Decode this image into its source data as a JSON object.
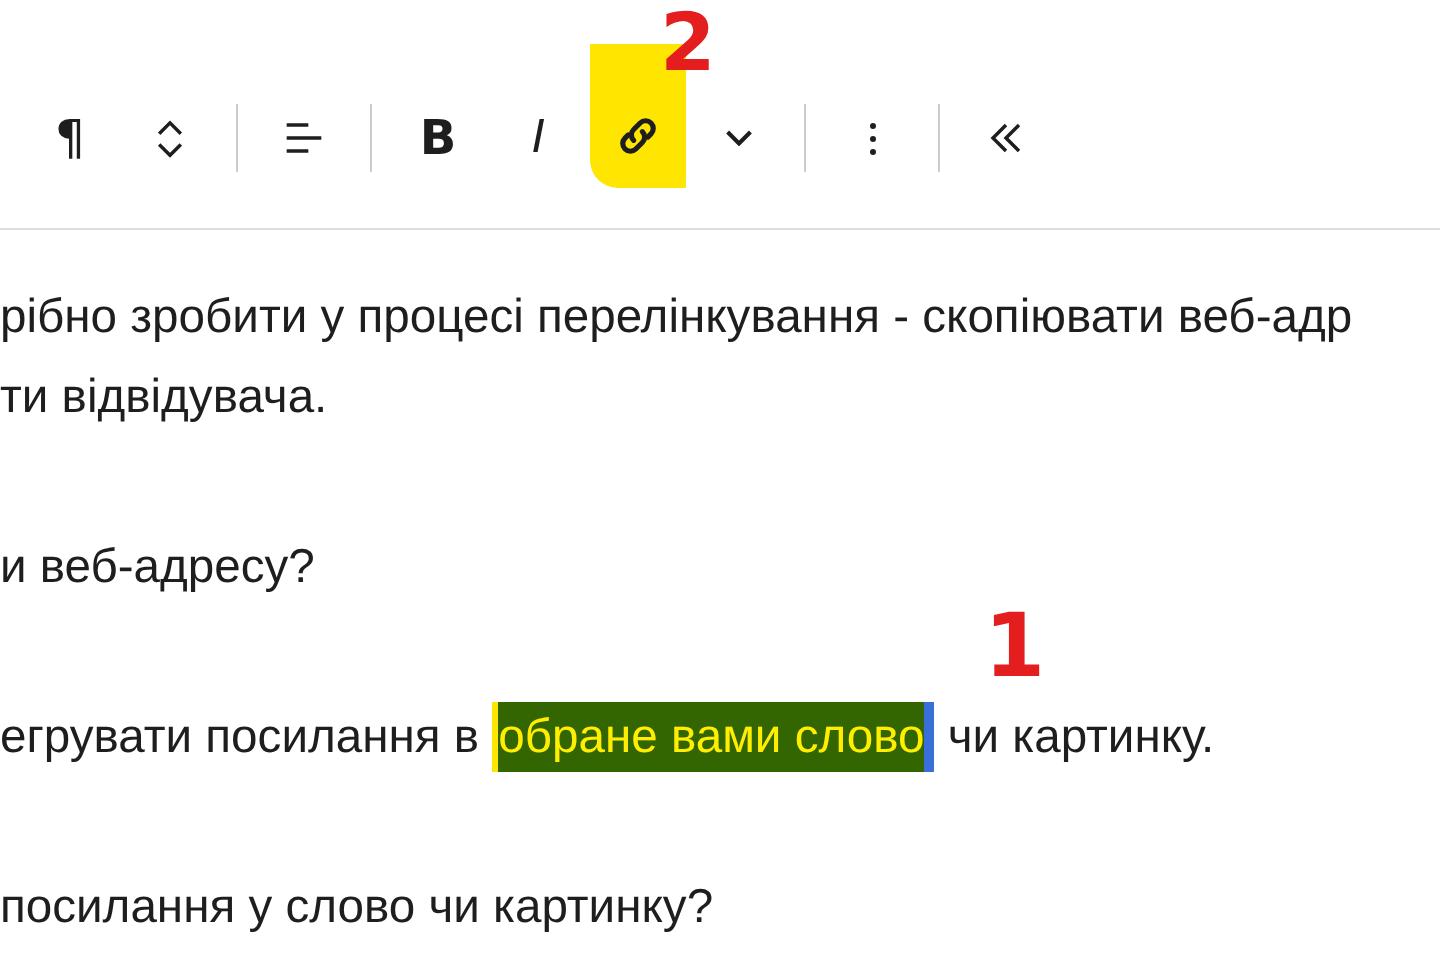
{
  "toolbar": {
    "groups": [
      [
        {
          "kind": "glyph",
          "label": "¶",
          "highlighted": false
        },
        {
          "kind": "mover",
          "highlighted": false
        }
      ],
      [
        {
          "kind": "align",
          "highlighted": false
        }
      ],
      [
        {
          "kind": "bold",
          "label": "B",
          "highlighted": false
        },
        {
          "kind": "italic",
          "label": "I",
          "highlighted": false
        },
        {
          "kind": "link",
          "highlighted": true
        },
        {
          "kind": "caret",
          "highlighted": false
        }
      ],
      [
        {
          "kind": "options",
          "highlighted": false
        }
      ],
      [
        {
          "kind": "collapse",
          "highlighted": false
        }
      ]
    ]
  },
  "paragraphs": [
    {
      "lines": [
        [
          {
            "text": "рібно зробити у процесі перелінкування - скопіювати веб-адр",
            "highlighted": false
          }
        ],
        [
          {
            "text": "ти відвідувача.",
            "highlighted": false
          }
        ]
      ]
    },
    {
      "lines": [
        [
          {
            "text": "и веб-адресу?",
            "highlighted": false
          }
        ]
      ]
    },
    {
      "lines": [
        [
          {
            "text": "егрувати посилання в ",
            "highlighted": false
          },
          {
            "text": "обране вами слово",
            "highlighted": true
          },
          {
            "text": " чи картинку.",
            "highlighted": false
          }
        ]
      ]
    },
    {
      "lines": [
        [
          {
            "text": "посилання у слово чи картинку?",
            "highlighted": false
          }
        ]
      ]
    }
  ],
  "annotations": [
    {
      "label": "2",
      "kind": "toolbar"
    },
    {
      "label": "1",
      "kind": "text"
    }
  ]
}
